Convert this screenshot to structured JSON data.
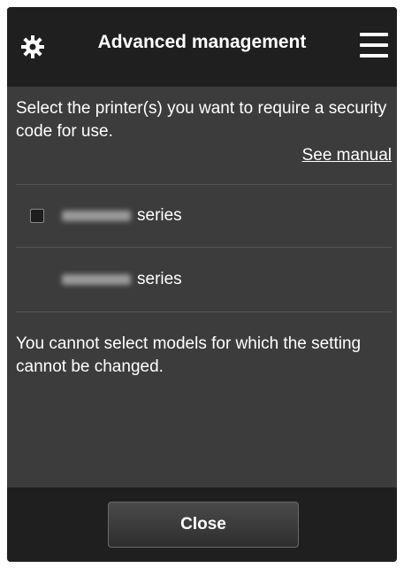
{
  "header": {
    "title": "Advanced management",
    "settings_icon": "gear-icon",
    "menu_icon": "hamburger-menu-icon"
  },
  "instructions": "Select the printer(s) you want to require a security code for use.",
  "see_manual": "See manual",
  "printers": [
    {
      "model_label": "series",
      "checkbox": true,
      "checked": false
    },
    {
      "model_label": "series",
      "checkbox": false,
      "checked": false
    }
  ],
  "note": "You cannot select models for which the setting cannot be changed.",
  "footer": {
    "close_label": "Close"
  },
  "colors": {
    "header_bg": "#1f1f1f",
    "body_bg": "#3c3c3c",
    "text": "#ffffff"
  }
}
